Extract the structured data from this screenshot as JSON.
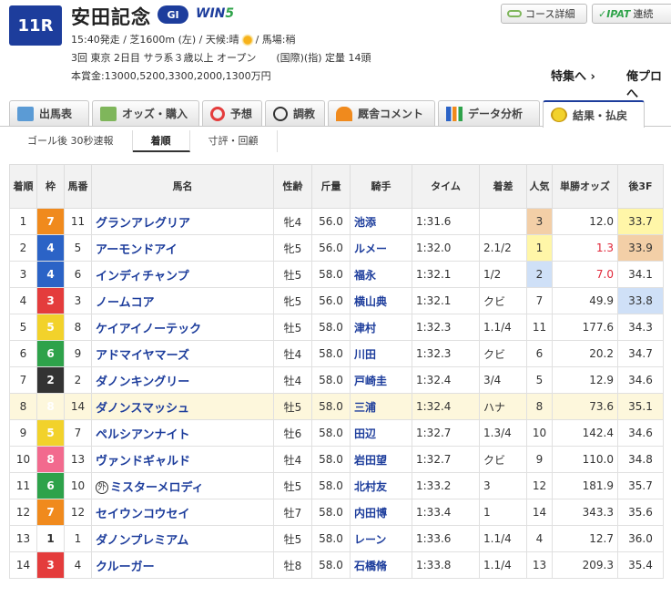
{
  "race": {
    "number": "11R",
    "name": "安田記念",
    "grade": "GI",
    "win5": {
      "a": "WIN",
      "b": "5"
    },
    "line1a": "15:40発走 / 芝1600m (左) / 天候:晴",
    "line1b": "/ 馬場:稍",
    "line2": "3回 東京 2日目 サラ系３歳以上 オープン　　(国際)(指) 定量 14頭",
    "line3": "本賞金:13000,5200,3300,2000,1300万円"
  },
  "buttons": {
    "course": "コース詳細",
    "ipat_logo": "IPAT",
    "ipat_label": "連続"
  },
  "links": {
    "feature": "特集へ",
    "blog": "俺プロへ"
  },
  "tabs": [
    "出馬表",
    "オッズ・購入",
    "予想",
    "調教",
    "厩舎コメント",
    "データ分析",
    "結果・払戻"
  ],
  "subtabs": [
    "ゴール後 30秒速報",
    "着順",
    "寸評・回顧"
  ],
  "columns": [
    "着順",
    "枠",
    "馬番",
    "馬名",
    "性齢",
    "斤量",
    "騎手",
    "タイム",
    "着差",
    "人気",
    "単勝オッズ",
    "後3F"
  ],
  "rows": [
    {
      "rank": "1",
      "waku": "7",
      "num": "11",
      "name": "グランアレグリア",
      "sex": "牝4",
      "weight": "56.0",
      "jockey": "池添",
      "time": "1:31.6",
      "margin": "",
      "pop": "3",
      "odds": "12.0",
      "l3f": "33.7"
    },
    {
      "rank": "2",
      "waku": "4",
      "num": "5",
      "name": "アーモンドアイ",
      "sex": "牝5",
      "weight": "56.0",
      "jockey": "ルメー",
      "time": "1:32.0",
      "margin": "2.1/2",
      "pop": "1",
      "odds": "1.3",
      "l3f": "33.9"
    },
    {
      "rank": "3",
      "waku": "4",
      "num": "6",
      "name": "インディチャンプ",
      "sex": "牡5",
      "weight": "58.0",
      "jockey": "福永",
      "time": "1:32.1",
      "margin": "1/2",
      "pop": "2",
      "odds": "7.0",
      "l3f": "34.1"
    },
    {
      "rank": "4",
      "waku": "3",
      "num": "3",
      "name": "ノームコア",
      "sex": "牝5",
      "weight": "56.0",
      "jockey": "横山典",
      "time": "1:32.1",
      "margin": "クビ",
      "pop": "7",
      "odds": "49.9",
      "l3f": "33.8"
    },
    {
      "rank": "5",
      "waku": "5",
      "num": "8",
      "name": "ケイアイノーテック",
      "sex": "牡5",
      "weight": "58.0",
      "jockey": "津村",
      "time": "1:32.3",
      "margin": "1.1/4",
      "pop": "11",
      "odds": "177.6",
      "l3f": "34.3"
    },
    {
      "rank": "6",
      "waku": "6",
      "num": "9",
      "name": "アドマイヤマーズ",
      "sex": "牡4",
      "weight": "58.0",
      "jockey": "川田",
      "time": "1:32.3",
      "margin": "クビ",
      "pop": "6",
      "odds": "20.2",
      "l3f": "34.7"
    },
    {
      "rank": "7",
      "waku": "2",
      "num": "2",
      "name": "ダノンキングリー",
      "sex": "牡4",
      "weight": "58.0",
      "jockey": "戸崎圭",
      "time": "1:32.4",
      "margin": "3/4",
      "pop": "5",
      "odds": "12.9",
      "l3f": "34.6"
    },
    {
      "rank": "8",
      "waku": "8",
      "num": "14",
      "name": "ダノンスマッシュ",
      "sex": "牡5",
      "weight": "58.0",
      "jockey": "三浦",
      "time": "1:32.4",
      "margin": "ハナ",
      "pop": "8",
      "odds": "73.6",
      "l3f": "35.1"
    },
    {
      "rank": "9",
      "waku": "5",
      "num": "7",
      "name": "ペルシアンナイト",
      "sex": "牡6",
      "weight": "58.0",
      "jockey": "田辺",
      "time": "1:32.7",
      "margin": "1.3/4",
      "pop": "10",
      "odds": "142.4",
      "l3f": "34.6"
    },
    {
      "rank": "10",
      "waku": "8",
      "num": "13",
      "name": "ヴァンドギャルド",
      "sex": "牡4",
      "weight": "58.0",
      "jockey": "岩田望",
      "time": "1:32.7",
      "margin": "クビ",
      "pop": "9",
      "odds": "110.0",
      "l3f": "34.8"
    },
    {
      "rank": "11",
      "waku": "6",
      "num": "10",
      "name": "ミスターメロディ",
      "gai": "外",
      "sex": "牡5",
      "weight": "58.0",
      "jockey": "北村友",
      "time": "1:33.2",
      "margin": "3",
      "pop": "12",
      "odds": "181.9",
      "l3f": "35.7"
    },
    {
      "rank": "12",
      "waku": "7",
      "num": "12",
      "name": "セイウンコウセイ",
      "sex": "牡7",
      "weight": "58.0",
      "jockey": "内田博",
      "time": "1:33.4",
      "margin": "1",
      "pop": "14",
      "odds": "343.3",
      "l3f": "35.6"
    },
    {
      "rank": "13",
      "waku": "1",
      "num": "1",
      "name": "ダノンプレミアム",
      "sex": "牡5",
      "weight": "58.0",
      "jockey": "レーン",
      "time": "1:33.6",
      "margin": "1.1/4",
      "pop": "4",
      "odds": "12.7",
      "l3f": "36.0"
    },
    {
      "rank": "14",
      "waku": "3",
      "num": "4",
      "name": "クルーガー",
      "sex": "牡8",
      "weight": "58.0",
      "jockey": "石橋脩",
      "time": "1:33.8",
      "margin": "1.1/4",
      "pop": "13",
      "odds": "209.3",
      "l3f": "35.4"
    }
  ],
  "colors": {
    "accent": "#1d3d9c",
    "highlight_row": "#fdf7dc",
    "odds_red": "#e0283a"
  }
}
